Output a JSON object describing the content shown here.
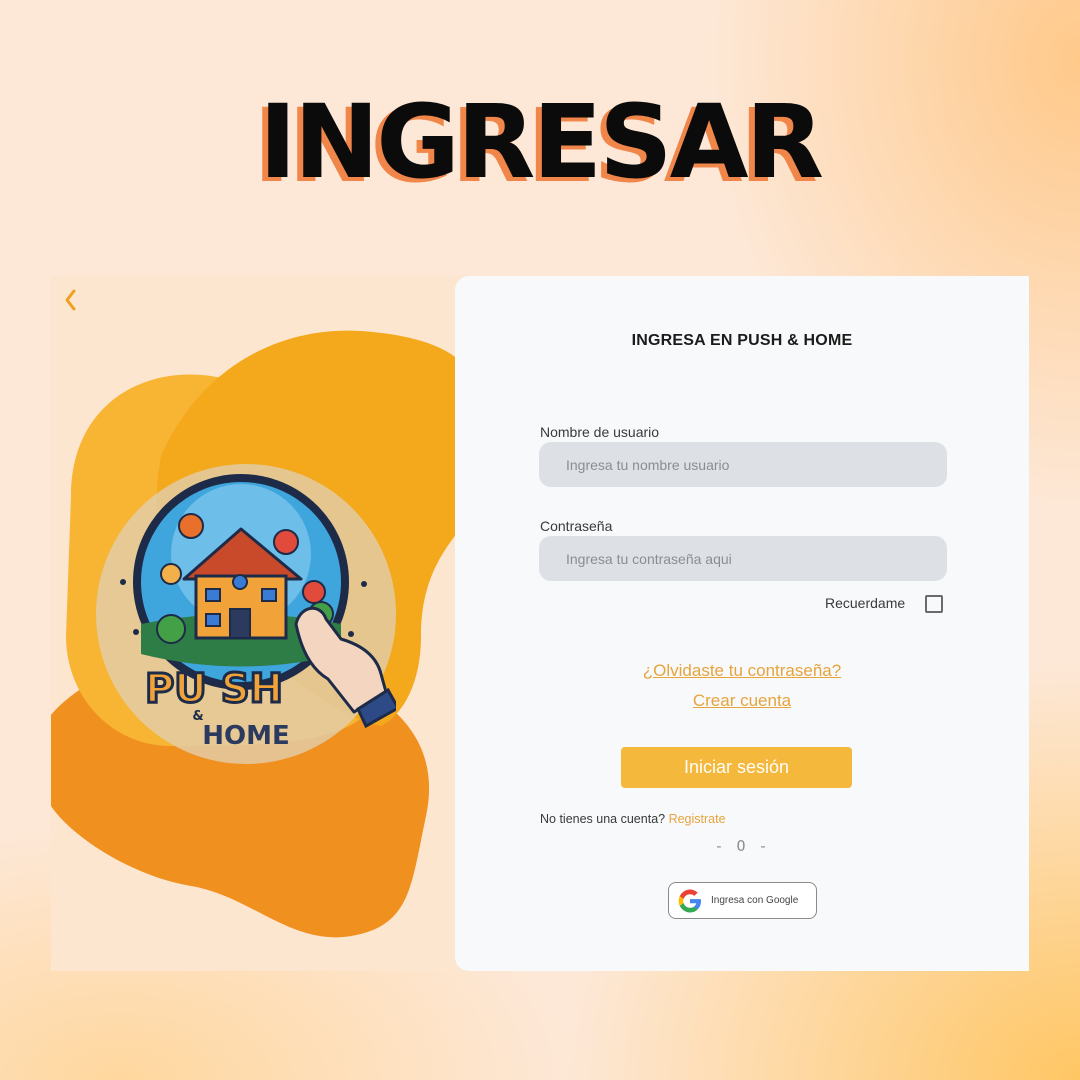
{
  "heading": "INGRESAR",
  "left_panel": {
    "back_icon": "chevron-left-icon",
    "logo": {
      "icon": "push-and-home-logo",
      "text_top": "PU SH",
      "text_mid": "&",
      "text_bottom": "HOME"
    }
  },
  "card": {
    "title": "INGRESA EN PUSH & HOME",
    "username": {
      "label": "Nombre de usuario",
      "placeholder": "Ingresa tu nombre usuario",
      "value": ""
    },
    "password": {
      "label": "Contraseña",
      "placeholder": "Ingresa tu contraseña aqui",
      "value": ""
    },
    "remember": {
      "label": "Recuerdame",
      "checked": false
    },
    "forgot_link": "¿Olvidaste tu contraseña?",
    "create_link": "Crear cuenta",
    "login_button": "Iniciar sesión",
    "no_account_text": "No tienes una cuenta?",
    "register_link": "Registrate",
    "divider": "- O -",
    "google_button": {
      "icon": "google-icon",
      "label": "Ingresa con Google"
    }
  },
  "colors": {
    "accent": "#f4b83d",
    "link": "#e7a43c",
    "heading_shadow": "#f1864a",
    "blob_orange": "#f0901f",
    "blob_yellow": "#f4a81b",
    "input_bg": "#dde1e6",
    "card_bg": "#f7f9fb"
  }
}
